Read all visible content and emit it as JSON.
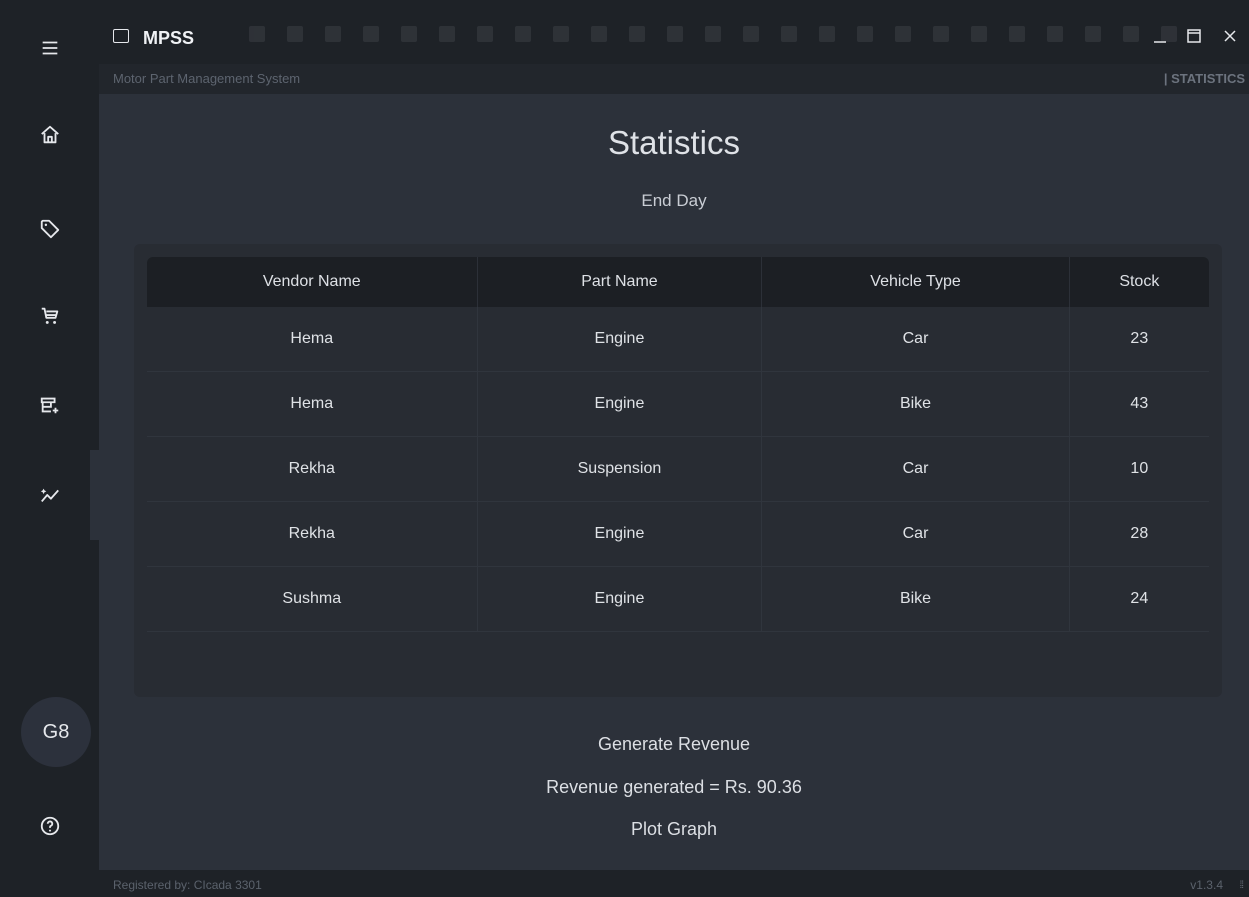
{
  "app": {
    "title": "MPSS",
    "subtitle": "Motor Part Management System",
    "section": "| STATISTICS"
  },
  "sidebar": {
    "items": [
      {
        "name": "menu",
        "icon": "hamburger-menu-icon"
      },
      {
        "name": "home",
        "icon": "home-icon"
      },
      {
        "name": "tags",
        "icon": "tag-icon"
      },
      {
        "name": "cart",
        "icon": "cart-icon"
      },
      {
        "name": "add-store",
        "icon": "store-add-icon"
      },
      {
        "name": "statistics",
        "icon": "sparkle-chart-icon",
        "active": true
      }
    ],
    "avatar": "G8",
    "help_icon": "help-icon"
  },
  "page": {
    "title": "Statistics",
    "subtitle": "End Day"
  },
  "table": {
    "headers": [
      "Vendor Name",
      "Part Name",
      "Vehicle Type",
      "Stock"
    ],
    "rows": [
      [
        "Hema",
        "Engine",
        "Car",
        "23"
      ],
      [
        "Hema",
        "Engine",
        "Bike",
        "43"
      ],
      [
        "Rekha",
        "Suspension",
        "Car",
        "10"
      ],
      [
        "Rekha",
        "Engine",
        "Car",
        "28"
      ],
      [
        "Sushma",
        "Engine",
        "Bike",
        "24"
      ]
    ]
  },
  "actions": {
    "generate_revenue": "Generate Revenue",
    "revenue_text": "Revenue generated = Rs. 90.36",
    "plot_graph": "Plot Graph"
  },
  "footer": {
    "registered": "Registered by: CIcada 3301",
    "version": "v1.3.4"
  },
  "colors": {
    "background": "#2c313a",
    "sidebar": "#1e2227",
    "table_header": "#1c1f24"
  }
}
